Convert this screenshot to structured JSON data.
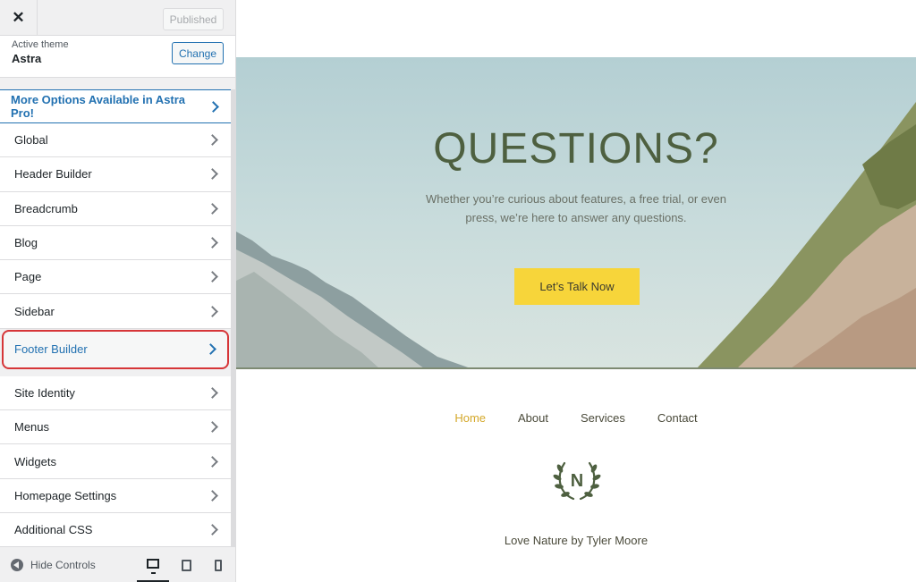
{
  "topbar": {
    "close_label": "✕",
    "publish_label": "Published"
  },
  "theme": {
    "caption": "Active theme",
    "name": "Astra",
    "change_label": "Change"
  },
  "promo": {
    "label": "More Options Available in Astra Pro!"
  },
  "menu_group1": [
    "Global",
    "Header Builder",
    "Breadcrumb",
    "Blog",
    "Page",
    "Sidebar"
  ],
  "active_item": "Footer Builder",
  "menu_group2": [
    "Site Identity",
    "Menus",
    "Widgets",
    "Homepage Settings",
    "Additional CSS"
  ],
  "footer": {
    "hide_label": "Hide Controls"
  },
  "preview": {
    "hero_title": "QUESTIONS?",
    "hero_subtitle": "Whether you’re curious about features, a free trial, or even press, we’re here to answer any questions.",
    "cta_label": "Let’s Talk Now",
    "nav": [
      "Home",
      "About",
      "Services",
      "Contact"
    ],
    "logo_letter": "N",
    "credit": "Love Nature by Tyler Moore"
  },
  "colors": {
    "accent": "#2271b1",
    "highlight": "#d63638",
    "cta": "#f7d53a",
    "title": "#4e6040",
    "nav_current": "#d4a82a"
  }
}
